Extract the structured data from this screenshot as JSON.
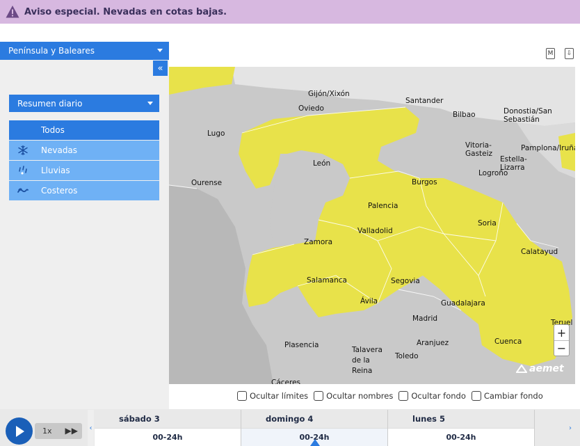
{
  "alert": {
    "text": "Aviso especial. Nevadas en cotas bajas.",
    "color": "#d7b8e0"
  },
  "region_selector": {
    "value": "Península y Baleares"
  },
  "collapse_button": {
    "label": "«"
  },
  "summary_selector": {
    "value": "Resumen diario"
  },
  "filters": [
    {
      "label": "Todos",
      "icon": "none",
      "active": true
    },
    {
      "label": "Nevadas",
      "icon": "snowflake-icon",
      "active": false
    },
    {
      "label": "Lluvias",
      "icon": "rain-icon",
      "active": false
    },
    {
      "label": "Costeros",
      "icon": "waves-icon",
      "active": false
    }
  ],
  "tools": {
    "m_label": "M",
    "download_label": "⇩"
  },
  "map": {
    "warning_color": "#e8e24a",
    "cities": [
      "Gijón/Xixón",
      "Santander",
      "Oviedo",
      "Bilbao",
      "Donostia/San Sebastián",
      "Lugo",
      "Vitoria-Gasteiz",
      "Pamplona/Iruña",
      "Estella-Lizarra",
      "Logroño",
      "León",
      "Burgos",
      "Ourense",
      "Palencia",
      "Soria",
      "Valladolid",
      "Zamora",
      "Calatayud",
      "Salamanca",
      "Segovia",
      "Ávila",
      "Guadalajara",
      "Madrid",
      "Teruel",
      "Plasencia",
      "Talavera de la Reina",
      "Aranjuez",
      "Toledo",
      "Cuenca",
      "Cáceres"
    ],
    "zoom_in": "+",
    "zoom_out": "−",
    "logo": "aemet"
  },
  "options": [
    {
      "label": "Ocultar límites"
    },
    {
      "label": "Ocultar nombres"
    },
    {
      "label": "Ocultar fondo"
    },
    {
      "label": "Cambiar fondo"
    }
  ],
  "timeline": {
    "speed": "1x",
    "days": [
      {
        "day": "sábado 3",
        "slot": "00-24h",
        "active": false
      },
      {
        "day": "domingo 4",
        "slot": "00-24h",
        "active": true
      },
      {
        "day": "lunes 5",
        "slot": "00-24h",
        "active": false
      }
    ],
    "prev": "‹",
    "next": "›"
  }
}
